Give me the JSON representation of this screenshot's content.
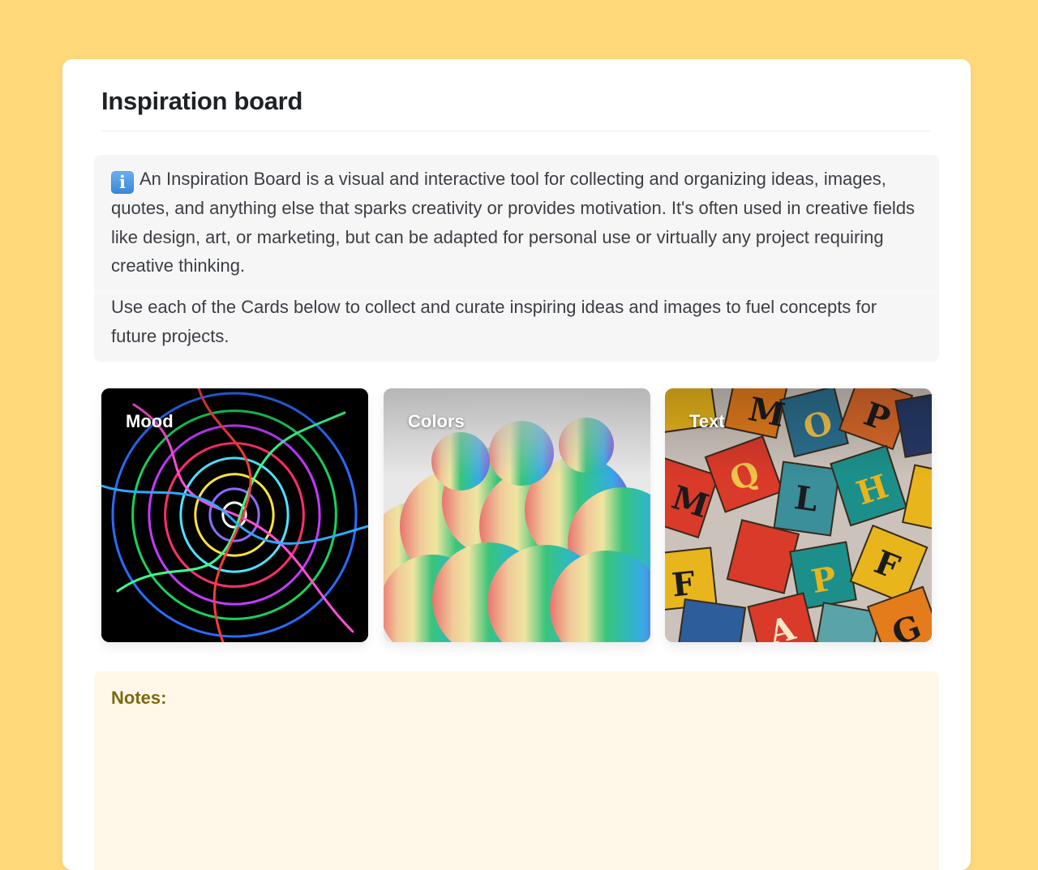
{
  "page": {
    "title": "Inspiration board"
  },
  "info": {
    "icon": "info-icon",
    "icon_glyph": "i",
    "paragraph_1": "An Inspiration Board is a visual and interactive tool for collecting and organizing ideas, images, quotes, and anything else that sparks creativity or provides motivation. It's often used in creative fields like design, art, or marketing, but can be adapted for personal use or virtually any project requiring creative thinking.",
    "paragraph_2": "Use each of the Cards below to collect and curate inspiring ideas and images to fuel concepts for future projects."
  },
  "cards": [
    {
      "label": "Mood",
      "image": "neon-swirl-image"
    },
    {
      "label": "Colors",
      "image": "rainbow-ink-cloud-image"
    },
    {
      "label": "Text",
      "image": "alphabet-tiles-image"
    }
  ],
  "notes": {
    "label": "Notes:"
  },
  "colors": {
    "background": "#ffd97a",
    "card_background": "#ffffff",
    "info_panel": "#f6f6f7",
    "notes_panel": "#fff8e8",
    "notes_label": "#7d6a12"
  }
}
